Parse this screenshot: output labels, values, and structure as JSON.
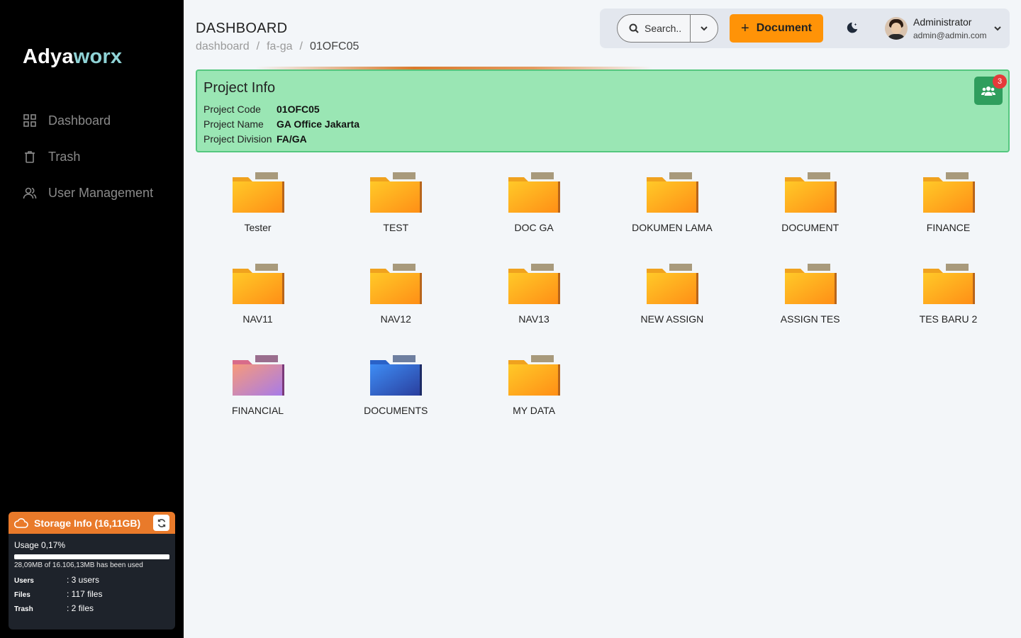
{
  "app": {
    "logo_main": "Adya",
    "logo_accent": "worx"
  },
  "sidebar": {
    "items": [
      {
        "label": "Dashboard",
        "icon": "grid-icon"
      },
      {
        "label": "Trash",
        "icon": "trash-icon"
      },
      {
        "label": "User Management",
        "icon": "users-icon"
      }
    ]
  },
  "storage": {
    "title": "Storage Info (16,11GB)",
    "usage": "Usage 0,17%",
    "usage_percent": 0.17,
    "used_text": "28,09MB of 16.106,13MB has been used",
    "stats": [
      {
        "label": "Users",
        "value": ": 3 users"
      },
      {
        "label": "Files",
        "value": ": 117 files"
      },
      {
        "label": "Trash",
        "value": ": 2 files"
      }
    ]
  },
  "header": {
    "title": "DASHBOARD",
    "breadcrumb": [
      "dashboard",
      "fa-ga",
      "01OFC05"
    ],
    "separator": "/"
  },
  "topbar": {
    "search_label": "Search..",
    "document_button": "Document",
    "user_name": "Administrator",
    "user_email": "admin@admin.com"
  },
  "project": {
    "title": "Project Info",
    "rows": [
      {
        "label": "Project Code",
        "value": "01OFC05"
      },
      {
        "label": "Project Name",
        "value": "GA Office Jakarta"
      },
      {
        "label": "Project Division",
        "value": "FA/GA"
      }
    ],
    "team_count": "3",
    "colors": {
      "background": "#9ae6b4",
      "border": "#55c77f",
      "button": "#2f9e5d",
      "badge": "#e53a3a"
    }
  },
  "folders": [
    {
      "label": "Tester",
      "color": "orange"
    },
    {
      "label": "TEST",
      "color": "orange"
    },
    {
      "label": "DOC GA",
      "color": "orange"
    },
    {
      "label": "DOKUMEN LAMA",
      "color": "orange"
    },
    {
      "label": "DOCUMENT",
      "color": "orange"
    },
    {
      "label": "FINANCE",
      "color": "orange"
    },
    {
      "label": "NAV11",
      "color": "orange"
    },
    {
      "label": "NAV12",
      "color": "orange"
    },
    {
      "label": "NAV13",
      "color": "orange"
    },
    {
      "label": "NEW ASSIGN",
      "color": "orange"
    },
    {
      "label": "ASSIGN TES",
      "color": "orange"
    },
    {
      "label": "TES BARU 2",
      "color": "orange"
    },
    {
      "label": "FINANCIAL",
      "color": "pink"
    },
    {
      "label": "DOCUMENTS",
      "color": "blue"
    },
    {
      "label": "MY DATA",
      "color": "orange"
    }
  ],
  "theme": {
    "accent": "#ff9307",
    "storage_header": "#e97a2a",
    "sidebar_bg": "#000000"
  }
}
